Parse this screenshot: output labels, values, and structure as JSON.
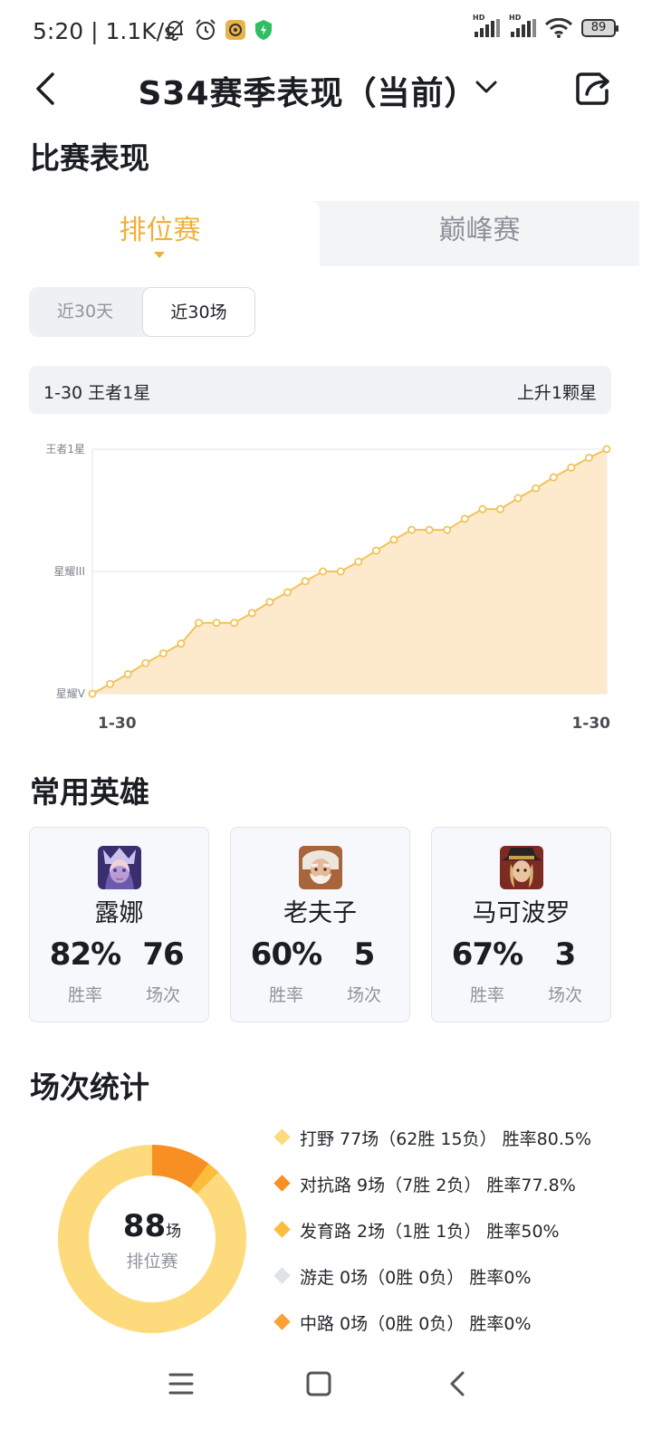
{
  "status_bar": {
    "time_speed": "5:20 | 1.1K/s",
    "signal_1_label": "HD",
    "signal_2_label": "HD",
    "battery": "89"
  },
  "header": {
    "title": "S34赛季表现（当前）"
  },
  "performance": {
    "section_title": "比赛表现",
    "tabs": [
      "排位赛",
      "巅峰赛"
    ],
    "active_tab": "排位赛",
    "range_buttons": [
      "近30天",
      "近30场"
    ],
    "active_range": "近30场",
    "rank_summary": {
      "left": "1-30 王者1星",
      "right": "上升1颗星"
    }
  },
  "chart_data": {
    "type": "area",
    "y_ticks": [
      "星耀V",
      "星耀III",
      "王者1星"
    ],
    "x_ticks": [
      "1-30",
      "1-30"
    ],
    "x": [
      1,
      2,
      3,
      4,
      5,
      6,
      7,
      8,
      9,
      10,
      11,
      12,
      13,
      14,
      15,
      16,
      17,
      18,
      19,
      20,
      21,
      22,
      23,
      24,
      25,
      26,
      27,
      28,
      29,
      30
    ],
    "values": [
      0,
      0.4,
      0.8,
      1.25,
      1.65,
      2.05,
      2.9,
      2.9,
      2.9,
      3.3,
      3.75,
      4.15,
      4.6,
      5.0,
      5.0,
      5.4,
      5.85,
      6.3,
      6.7,
      6.7,
      6.7,
      7.15,
      7.55,
      7.55,
      8.0,
      8.4,
      8.85,
      9.25,
      9.65,
      10.0
    ],
    "ylim": [
      0,
      10
    ],
    "y_tick_values": [
      0,
      5,
      10
    ],
    "grid": true,
    "colors": {
      "line": "#f2c35a",
      "fill": "#fde9cc",
      "marker_fill": "#ffffff"
    }
  },
  "heroes": {
    "section_title": "常用英雄",
    "win_label": "胜率",
    "games_label": "场次",
    "items": [
      {
        "name": "露娜",
        "win_rate": "82%",
        "games": "76",
        "avatar": "luna-portrait"
      },
      {
        "name": "老夫子",
        "win_rate": "60%",
        "games": "5",
        "avatar": "old-master-portrait"
      },
      {
        "name": "马可波罗",
        "win_rate": "67%",
        "games": "3",
        "avatar": "marco-polo-portrait"
      }
    ]
  },
  "match_stats": {
    "section_title": "场次统计",
    "total": "88",
    "total_unit": "场",
    "total_label": "排位赛",
    "segments": [
      {
        "label": "打野 77场（62胜 15负） 胜率80.5%",
        "games": 77,
        "color": "#fddb7d"
      },
      {
        "label": "对抗路 9场（7胜 2负） 胜率77.8%",
        "games": 9,
        "color": "#f78f22"
      },
      {
        "label": "发育路 2场（1胜 1负） 胜率50%",
        "games": 2,
        "color": "#fbbd3b"
      },
      {
        "label": "游走 0场（0胜 0负） 胜率0%",
        "games": 0,
        "color": "#dfe3e6"
      },
      {
        "label": "中路 0场（0胜 0负） 胜率0%",
        "games": 0,
        "color": "#f9a233"
      }
    ]
  },
  "nav": {
    "icons": [
      "menu-icon",
      "home-icon",
      "back-icon"
    ]
  }
}
